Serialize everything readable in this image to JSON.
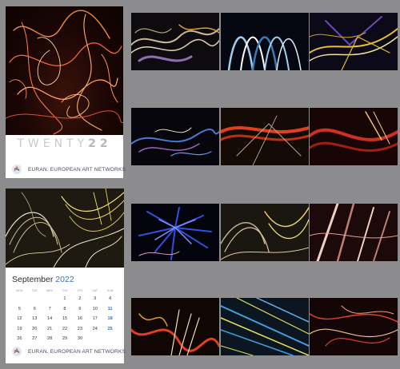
{
  "cover": {
    "title_light": "TWENTY",
    "title_bold": "22",
    "brand": "EURAN. EUROPEAN ART NETWORKS",
    "logo_icon": "euran-logo-icon"
  },
  "calendar": {
    "month": "September",
    "year": "2022",
    "weekdays": [
      "MON",
      "TUE",
      "WED",
      "THU",
      "FRI",
      "SAT",
      "SUN"
    ],
    "weeks": [
      [
        "",
        "",
        "",
        "1",
        "2",
        "3",
        "4"
      ],
      [
        "5",
        "6",
        "7",
        "8",
        "9",
        "10",
        "11"
      ],
      [
        "12",
        "13",
        "14",
        "15",
        "16",
        "17",
        "18"
      ],
      [
        "19",
        "20",
        "21",
        "22",
        "23",
        "24",
        "25"
      ],
      [
        "26",
        "27",
        "28",
        "29",
        "30",
        "",
        ""
      ]
    ],
    "brand": "EURAN. EUROPEAN ART NETWORKS",
    "accent_color": "#3e73b8"
  },
  "thumbnails": [
    {
      "id": "thumb-1",
      "palette": [
        "#c9b89a",
        "#8b6fb0",
        "#e0a030"
      ]
    },
    {
      "id": "thumb-2",
      "palette": [
        "#9fd0f0",
        "#3a7ac0",
        "#ffffff"
      ]
    },
    {
      "id": "thumb-3",
      "palette": [
        "#e8c030",
        "#6a4ab0",
        "#f0e0a0"
      ]
    },
    {
      "id": "thumb-4",
      "palette": [
        "#4a7ad0",
        "#a060c0",
        "#e8e0c0"
      ]
    },
    {
      "id": "thumb-5",
      "palette": [
        "#e04020",
        "#c0a080",
        "#302010"
      ]
    },
    {
      "id": "thumb-6",
      "palette": [
        "#d03020",
        "#f0c060",
        "#401010"
      ]
    },
    {
      "id": "thumb-7",
      "palette": [
        "#3050e0",
        "#8090ff",
        "#e0a0c0"
      ]
    },
    {
      "id": "thumb-8",
      "palette": [
        "#e8d070",
        "#c0b090",
        "#504020"
      ]
    },
    {
      "id": "thumb-9",
      "palette": [
        "#f0d0c0",
        "#c08070",
        "#602020"
      ]
    },
    {
      "id": "thumb-10",
      "palette": [
        "#e04020",
        "#f0e0c0",
        "#e0a020"
      ]
    },
    {
      "id": "thumb-11",
      "palette": [
        "#40a0e0",
        "#e0e060",
        "#203040"
      ]
    },
    {
      "id": "thumb-12",
      "palette": [
        "#e04030",
        "#f0c090",
        "#301010"
      ]
    }
  ]
}
